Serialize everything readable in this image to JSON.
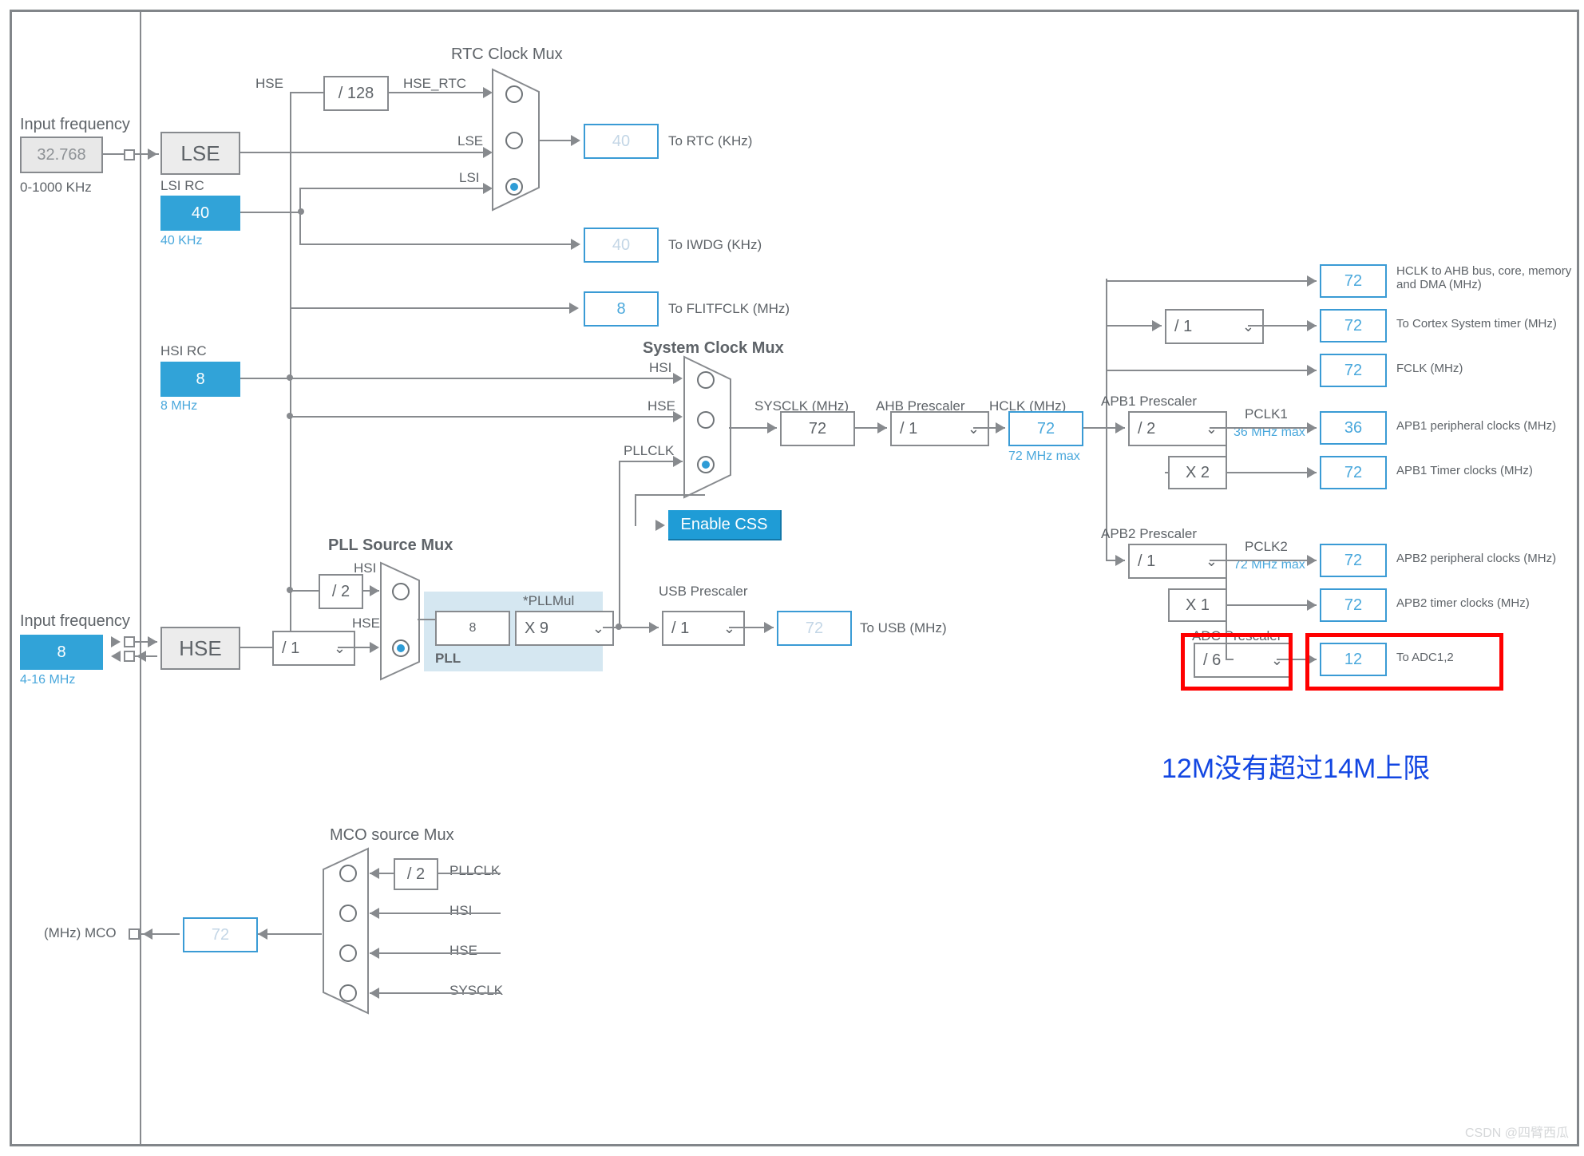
{
  "input_freq1_label": "Input frequency",
  "input_freq1_val": "32.768",
  "input_freq1_range": "0-1000 KHz",
  "lse": "LSE",
  "lsi_rc_label": "LSI RC",
  "lsi_val": "40",
  "lsi_unit": "40 KHz",
  "hsi_rc_label": "HSI RC",
  "hsi_val": "8",
  "hsi_unit": "8 MHz",
  "input_freq2_label": "Input frequency",
  "input_freq2_val": "8",
  "input_freq2_range": "4-16 MHz",
  "hse": "HSE",
  "rtc_mux_title": "RTC Clock Mux",
  "hse_div128": "/ 128",
  "hse_rtc": "HSE_RTC",
  "rtc_in_hse": "HSE",
  "rtc_in_lse": "LSE",
  "rtc_in_lsi": "LSI",
  "to_rtc_val": "40",
  "to_rtc_label": "To RTC (KHz)",
  "to_iwdg_val": "40",
  "to_iwdg_label": "To IWDG (KHz)",
  "to_flit_val": "8",
  "to_flit_label": "To FLITFCLK (MHz)",
  "sys_mux_title": "System Clock Mux",
  "sys_in_hsi": "HSI",
  "sys_in_hse": "HSE",
  "sys_in_pll": "PLLCLK",
  "enable_css": "Enable CSS",
  "sysclk_label": "SYSCLK (MHz)",
  "sysclk_val": "72",
  "ahb_pre_label": "AHB Prescaler",
  "ahb_pre_val": "/ 1",
  "hclk_label": "HCLK (MHz)",
  "hclk_val": "72",
  "hclk_max": "72 MHz max",
  "hclk_ahb_val": "72",
  "hclk_ahb_label": "HCLK to AHB bus, core, memory and DMA (MHz)",
  "cortex_div": "/ 1",
  "cortex_val": "72",
  "cortex_label": "To Cortex System timer (MHz)",
  "fclk_val": "72",
  "fclk_label": "FCLK (MHz)",
  "apb1_pre_label": "APB1 Prescaler",
  "apb1_pre_val": "/ 2",
  "pclk1_label": "PCLK1",
  "pclk1_max": "36 MHz max",
  "apb1_periph_val": "36",
  "apb1_periph_label": "APB1 peripheral clocks (MHz)",
  "apb1_timer_mul": "X 2",
  "apb1_timer_val": "72",
  "apb1_timer_label": "APB1 Timer clocks (MHz)",
  "apb2_pre_label": "APB2 Prescaler",
  "apb2_pre_val": "/ 1",
  "pclk2_label": "PCLK2",
  "pclk2_max": "72 MHz max",
  "apb2_periph_val": "72",
  "apb2_periph_label": "APB2 peripheral clocks (MHz)",
  "apb2_timer_mul": "X 1",
  "apb2_timer_val": "72",
  "apb2_timer_label": "APB2 timer clocks (MHz)",
  "adc_pre_label": "ADC Prescaler",
  "adc_pre_val": "/ 6",
  "adc_val": "12",
  "adc_label": "To ADC1,2",
  "pll_src_title": "PLL Source Mux",
  "pll_in_hsi": "HSI",
  "pll_div2": "/ 2",
  "pll_in_hse": "HSE",
  "hse_div": "/ 1",
  "pll_val": "8",
  "pll_mul_label": "*PLLMul",
  "pll_mul_val": "X 9",
  "pll_label": "PLL",
  "usb_pre_label": "USB Prescaler",
  "usb_pre_val": "/ 1",
  "to_usb_val": "72",
  "to_usb_label": "To USB (MHz)",
  "mco_title": "MCO source Mux",
  "mco_div2": "/ 2",
  "mco_in_pll": "PLLCLK",
  "mco_in_hsi": "HSI",
  "mco_in_hse": "HSE",
  "mco_in_sys": "SYSCLK",
  "mco_val": "72",
  "mco_label": "(MHz) MCO",
  "annotation": "12M没有超过14M上限",
  "watermark": "CSDN @四臂西瓜"
}
